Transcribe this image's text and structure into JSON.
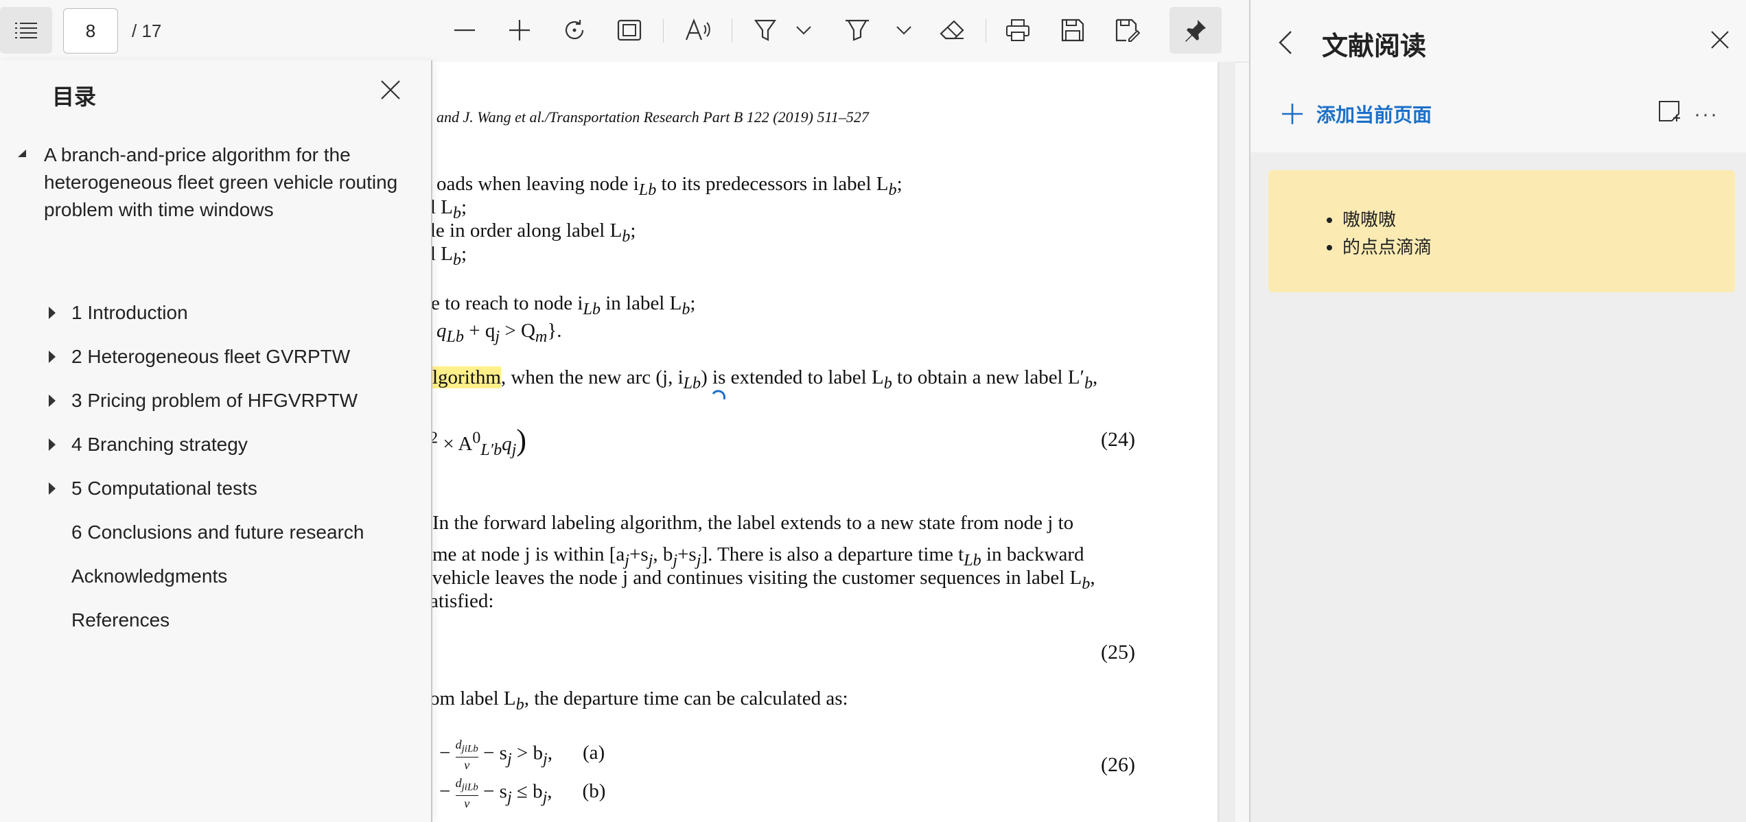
{
  "toolbar": {
    "current_page": "8",
    "total_pages": "/ 17"
  },
  "toc": {
    "title": "目录",
    "root": "A branch-and-price algorithm for the heterogeneous fleet green vehicle routing problem with time windows",
    "items": [
      {
        "label": "1 Introduction",
        "expandable": true
      },
      {
        "label": "2 Heterogeneous fleet GVRPTW",
        "expandable": true
      },
      {
        "label": "3 Pricing problem of HFGVRPTW",
        "expandable": true
      },
      {
        "label": "4 Branching strategy",
        "expandable": true
      },
      {
        "label": "5 Computational tests",
        "expandable": true
      },
      {
        "label": "6 Conclusions and future research",
        "expandable": false
      },
      {
        "label": "Acknowledgments",
        "expandable": false
      },
      {
        "label": "References",
        "expandable": false
      }
    ]
  },
  "document": {
    "header": "and J. Wang et al./Transportation Research Part B 122 (2019) 511–527",
    "lines": [
      "oads when leaving node i",
      "Lb",
      " to its predecessors in label L",
      "b",
      ";",
      "el L",
      "b",
      ";",
      "cle in order along label L",
      "b",
      ";",
      "el L",
      "b",
      ";",
      "e to reach to node i",
      "Lb",
      " in label L",
      "b",
      ";",
      "q",
      "Lb",
      " + q",
      "j",
      " > Q",
      "m",
      "}.",
      "lgorithm",
      ", when the new arc (j, i",
      "Lb",
      ") is extended to label L",
      "b",
      " to obtain a new label L′",
      "b",
      ",",
      "2",
      "× A",
      "0",
      "L′b",
      "q",
      "j",
      ")",
      "In the forward labeling algorithm, the label extends to a new state from node j to",
      "me at node j is within [a",
      "j",
      "+s",
      "j",
      ", b",
      "j",
      "+s",
      "j",
      "]. There is also a departure time t",
      "Lb",
      " in backward",
      " vehicle leaves the node j and continues visiting the customer sequences in label L",
      "b",
      ",",
      "atisfied:",
      "om label L",
      "b",
      ", the departure time can be calculated as:",
      "− ",
      "d",
      "jiLb",
      "v",
      " − s",
      "j",
      " > b",
      "j",
      ",",
      "(a)",
      "− ",
      "d",
      "jiLb",
      "v",
      " − s",
      "j",
      " ≤ b",
      "j",
      ",",
      "(b)"
    ],
    "equation_numbers": [
      "(24)",
      "(25)",
      "(26)"
    ]
  },
  "side_panel": {
    "title": "文献阅读",
    "add_label": "添加当前页面",
    "more": "···",
    "notes": [
      "嗷嗷嗷",
      "的点点滴滴"
    ],
    "accent": "#1a6fc9",
    "note_bg": "#fbebb3"
  }
}
